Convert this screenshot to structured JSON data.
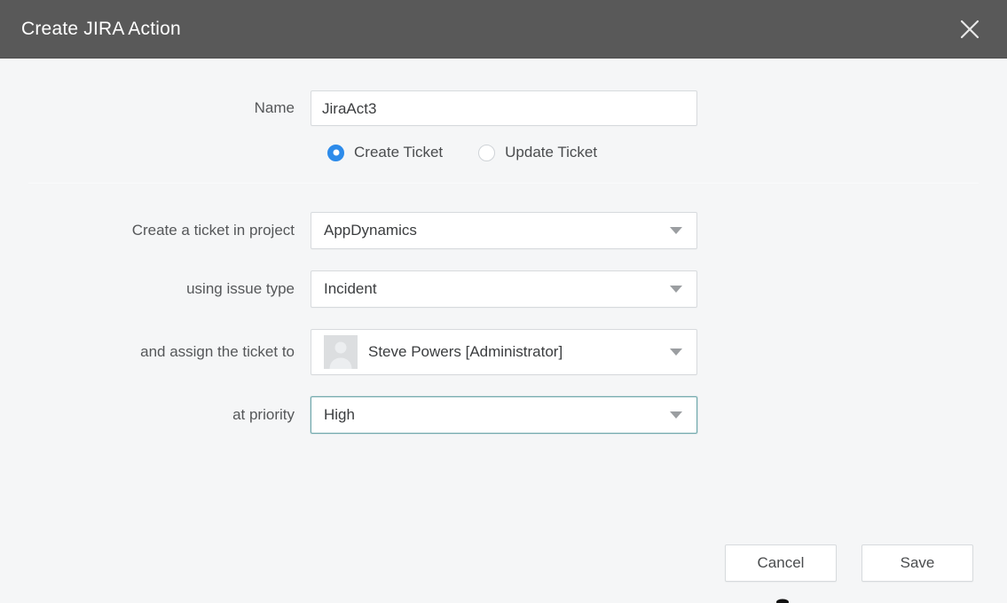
{
  "dialog": {
    "title": "Create JIRA Action",
    "close_icon": "close-icon"
  },
  "form": {
    "name": {
      "label": "Name",
      "value": "JiraAct3",
      "placeholder": ""
    },
    "ticket_mode": {
      "options": [
        {
          "label": "Create Ticket",
          "selected": true
        },
        {
          "label": "Update Ticket",
          "selected": false
        }
      ]
    },
    "project": {
      "label": "Create a ticket in project",
      "value": "AppDynamics"
    },
    "issue_type": {
      "label": "using issue type",
      "value": "Incident"
    },
    "assignee": {
      "label": "and assign the ticket to",
      "value": "Steve Powers [Administrator]",
      "avatar_icon": "user-avatar-icon"
    },
    "priority": {
      "label": "at priority",
      "value": "High",
      "focused": true
    }
  },
  "footer": {
    "cancel_label": "Cancel",
    "save_label": "Save"
  },
  "colors": {
    "titlebar_bg": "#595959",
    "titlebar_text": "#ffffff",
    "body_bg": "#f5f6f7",
    "radio_selected": "#2d8bea",
    "focus_border": "#6fa7ab",
    "field_border": "#d7dadd",
    "label_text": "#555759",
    "value_text": "#3b3d3f"
  }
}
